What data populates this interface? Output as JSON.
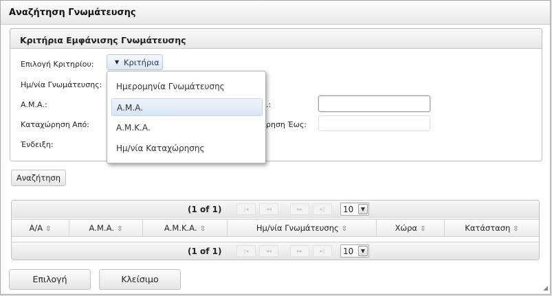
{
  "dialog": {
    "title": "Αναζήτηση Γνωμάτευσης"
  },
  "criteria": {
    "legend": "Κριτήρια Εμφάνισης Γνωμάτευσης",
    "labels": {
      "select_criterion": "Επιλογή Κριτηρίου:",
      "opinion_date": "Ημ/νία Γνωμάτευσης:",
      "ama": "Α.Μ.Α.:",
      "registration_from": "Καταχώρηση Από:",
      "indication": "Ένδειξη:",
      "right_field_partial": ".:",
      "registration_to_partial": "ρηση Έως:"
    },
    "criteria_button": "Κριτήρια",
    "dropdown_items": [
      "Ημερομηνία Γνωμάτευσης",
      "Α.Μ.Α.",
      "Α.Μ.Κ.Α.",
      "Ημ/νία Καταχώρησης"
    ],
    "selected_item": "Α.Μ.Α."
  },
  "search_button": "Αναζήτηση",
  "table": {
    "pager_info": "(1 of 1)",
    "rows_per_page": "10",
    "columns": [
      "Α/Α",
      "Α.Μ.Α.",
      "Α.Μ.Κ.Α.",
      "Ημ/νία Γνωμάτευσης",
      "Χώρα",
      "Κατάσταση"
    ]
  },
  "footer": {
    "select_button": "Επιλογή",
    "close_button": "Κλείσιμο"
  }
}
